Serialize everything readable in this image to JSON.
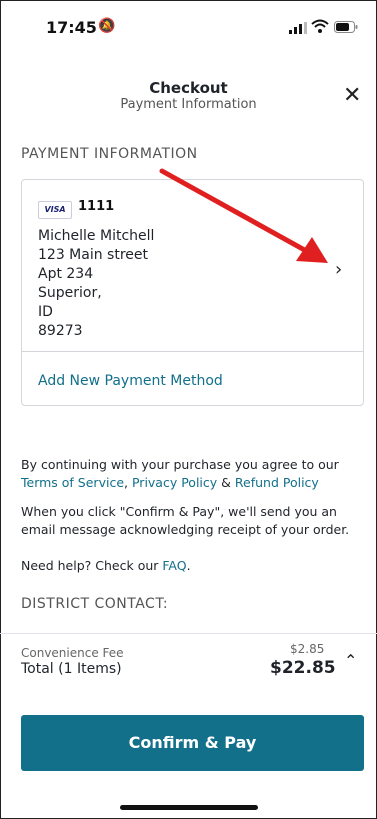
{
  "status_bar": {
    "time": "17:45"
  },
  "header": {
    "title": "Checkout",
    "subtitle": "Payment Information"
  },
  "payment": {
    "section_title": "PAYMENT INFORMATION",
    "card_brand": "VISA",
    "last4": "1111",
    "address_lines": [
      "Michelle Mitchell",
      "123 Main street",
      "Apt 234",
      "Superior,",
      "ID",
      "89273"
    ],
    "add_new_label": "Add New Payment Method"
  },
  "legal": {
    "agree_prefix": "By continuing with your purchase you agree to our",
    "terms": "Terms of Service",
    "comma": ",",
    "privacy": "Privacy Policy",
    "amp": "&",
    "refund": "Refund Policy",
    "confirm_text": "When you click \"Confirm & Pay\", we'll send you an email message acknowledging receipt of your order.",
    "help_prefix": "Need help? Check our",
    "faq": "FAQ",
    "period": "."
  },
  "district_title": "DISTRICT CONTACT:",
  "summary": {
    "fee_label": "Convenience Fee",
    "fee_value": "$2.85",
    "total_label": "Total (1 Items)",
    "total_value": "$22.85"
  },
  "confirm_button": "Confirm & Pay",
  "colors": {
    "accent": "#12708a",
    "annotation_arrow": "#e02020"
  }
}
